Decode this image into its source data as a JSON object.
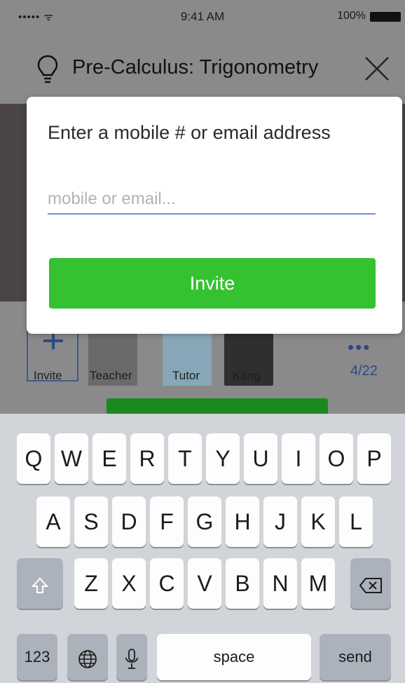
{
  "status_bar": {
    "signal": "••••• ᯤ",
    "time": "9:41 AM",
    "battery_percent": "100%"
  },
  "header": {
    "title": "Pre-Calculus: Trigonometry",
    "lightbulb_icon": "lightbulb-icon",
    "close_icon": "close-icon"
  },
  "members": {
    "invite_label": "Invite",
    "items": [
      {
        "label": "Teacher"
      },
      {
        "label": "Tutor"
      },
      {
        "label": "Kang"
      }
    ],
    "more": "•••",
    "count": "4/22"
  },
  "modal": {
    "prompt": "Enter a mobile # or email address",
    "input_value": "",
    "input_placeholder": "mobile or email...",
    "invite_button": "Invite",
    "accent_color": "#35c230",
    "underline_color": "#6f8fe0"
  },
  "keyboard": {
    "row1": [
      "Q",
      "W",
      "E",
      "R",
      "T",
      "Y",
      "U",
      "I",
      "O",
      "P"
    ],
    "row2": [
      "A",
      "S",
      "D",
      "F",
      "G",
      "H",
      "J",
      "K",
      "L"
    ],
    "row3": [
      "Z",
      "X",
      "C",
      "V",
      "B",
      "N",
      "M"
    ],
    "numbers_key": "123",
    "space_key": "space",
    "send_key": "send"
  }
}
